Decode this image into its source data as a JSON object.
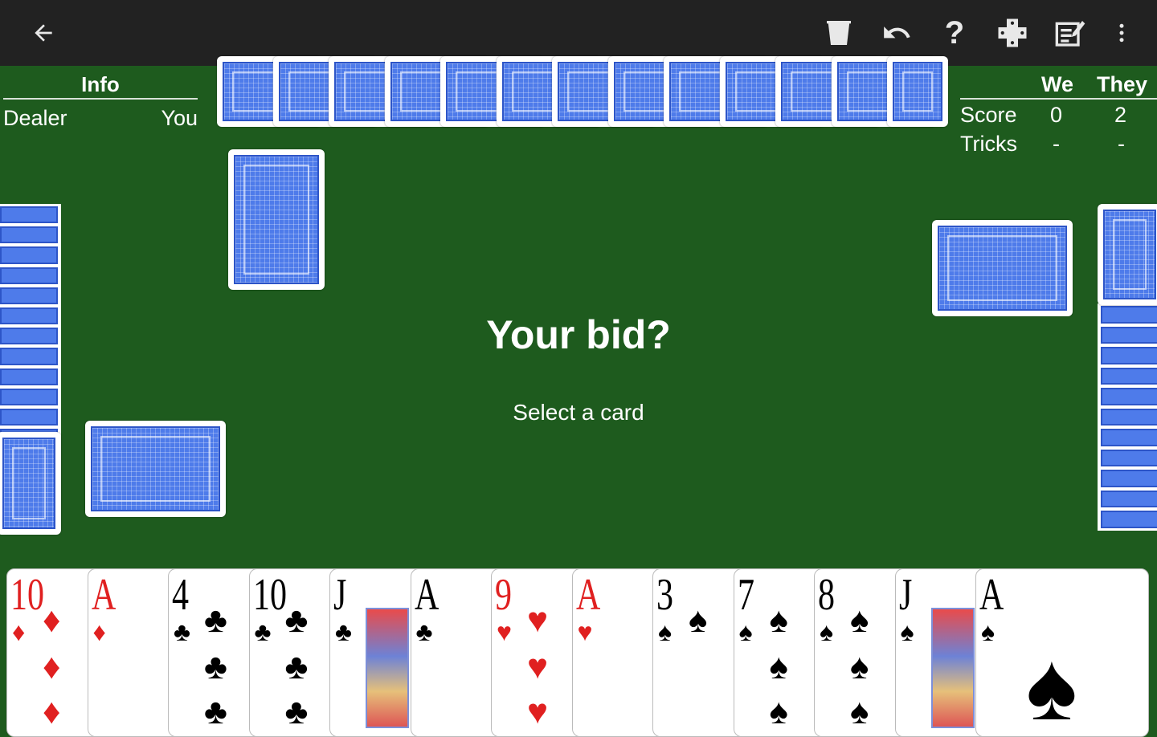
{
  "toolbar": {
    "back_icon": "arrow-left-icon",
    "actions": [
      "trash-icon",
      "undo-icon",
      "help-icon",
      "gamepad-icon",
      "score-sheet-icon",
      "more-vert-icon"
    ]
  },
  "info": {
    "title": "Info",
    "dealer_label": "Dealer",
    "dealer_value": "You"
  },
  "score": {
    "col_we": "We",
    "col_they": "They",
    "rows": [
      {
        "label": "Score",
        "we": "0",
        "they": "2"
      },
      {
        "label": "Tricks",
        "we": "-",
        "they": "-"
      }
    ]
  },
  "prompt": {
    "title": "Your bid?",
    "subtitle": "Select a card"
  },
  "colors": {
    "felt": "#1e5b1e",
    "toolbar": "#222222",
    "card_back": "#4e7bea",
    "red_suit": "#e02020"
  },
  "hand": [
    {
      "rank": "10",
      "suit": "♦",
      "color": "red"
    },
    {
      "rank": "A",
      "suit": "♦",
      "color": "red"
    },
    {
      "rank": "4",
      "suit": "♣",
      "color": "black"
    },
    {
      "rank": "10",
      "suit": "♣",
      "color": "black"
    },
    {
      "rank": "J",
      "suit": "♣",
      "color": "black"
    },
    {
      "rank": "A",
      "suit": "♣",
      "color": "black"
    },
    {
      "rank": "9",
      "suit": "♥",
      "color": "red"
    },
    {
      "rank": "A",
      "suit": "♥",
      "color": "red"
    },
    {
      "rank": "3",
      "suit": "♠",
      "color": "black"
    },
    {
      "rank": "7",
      "suit": "♠",
      "color": "black"
    },
    {
      "rank": "8",
      "suit": "♠",
      "color": "black"
    },
    {
      "rank": "J",
      "suit": "♠",
      "color": "black"
    },
    {
      "rank": "A",
      "suit": "♠",
      "color": "black"
    }
  ]
}
